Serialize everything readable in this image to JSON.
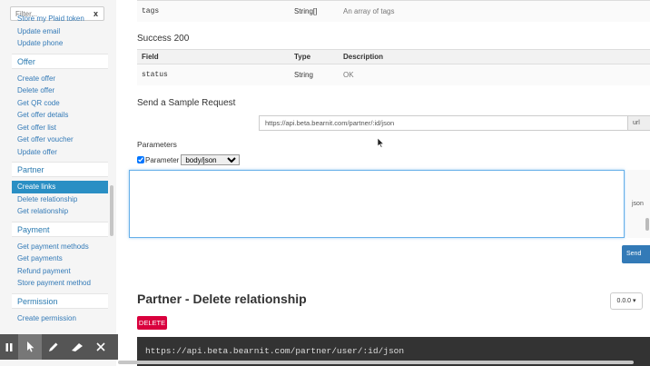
{
  "sidebar": {
    "filter_placeholder": "Filter...",
    "filter_clear": "x",
    "top_items": [
      "Store my Plaid token",
      "Update email",
      "Update phone"
    ],
    "sections": [
      {
        "title": "Offer",
        "items": [
          "Create offer",
          "Delete offer",
          "Get QR code",
          "Get offer details",
          "Get offer list",
          "Get offer voucher",
          "Update offer"
        ]
      },
      {
        "title": "Partner",
        "items": [
          "Create links",
          "Delete relationship",
          "Get relationship"
        ]
      },
      {
        "title": "Payment",
        "items": [
          "Get payment methods",
          "Get payments",
          "Refund payment",
          "Store payment method"
        ]
      },
      {
        "title": "Permission",
        "items": [
          "Create permission"
        ]
      }
    ],
    "active_item": "Create links"
  },
  "params_table": {
    "row": {
      "field": "tags",
      "type": "String[]",
      "description": "An array of tags"
    }
  },
  "success": {
    "title": "Success 200",
    "headers": {
      "field": "Field",
      "type": "Type",
      "description": "Description"
    },
    "row": {
      "field": "status",
      "type": "String",
      "description": "OK"
    }
  },
  "sample": {
    "title": "Send a Sample Request",
    "url": "https://api.beta.bearnit.com/partner/:id/json",
    "url_addon": "url",
    "parameters_label": "Parameters",
    "checkbox_label": "Parameter",
    "select_value": "body/json",
    "json_addon": "json",
    "send_label": "Send"
  },
  "section": {
    "title": "Partner - Delete relationship",
    "version": "0.0.0 ▾",
    "method": "DELETE",
    "endpoint": "https://api.beta.bearnit.com/partner/user/:id/json"
  },
  "colors": {
    "accent": "#337ab7",
    "active": "#2a8fc4",
    "delete": "#d9003d"
  }
}
